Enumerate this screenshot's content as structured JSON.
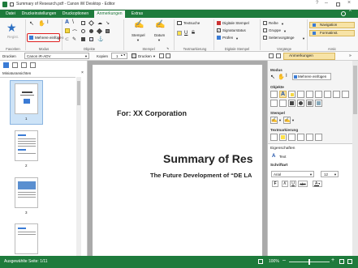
{
  "title": "Summary of Research.pdf - Canon iW Desktop - Editor",
  "tabs": [
    "Datei",
    "Druckeinstellungen",
    "Druckoptionen",
    "Anmerkungen",
    "Extras"
  ],
  "active_tab": "Anmerkungen",
  "ribbon": {
    "regist_label": "Regist.",
    "mehrere_einfuegen": "Mehrere einfügen",
    "stempel": "Stempel",
    "datum": "Datum",
    "textsuche": "Textsuche",
    "digitale_stempel": "Digitale Stempel",
    "signaturstatus": "Signaturstatus",
    "pruefen": "Prüfen",
    "reihe": "Reihe",
    "gruppe": "Gruppe",
    "seitenvorgaenge": "Seitenvorgänge",
    "navigation": "Navigation",
    "formatinst": "Formatinst.",
    "groups": {
      "favoriten": "Favoriten",
      "modus": "Modus",
      "objekte": "Objekte",
      "stempel": "Stempel",
      "textmarkierung": "Textmarkierung",
      "digitale_stempel": "Digitale Stempel",
      "vorgaenge": "Vorgänge",
      "ansic": "Ansic"
    }
  },
  "toolbar": {
    "drucken_label": "Drucken",
    "printer": "Canon iR-ADV",
    "kopien_label": "Kopien",
    "kopien_value": "1",
    "drucken_button": "Drucken",
    "anmerkungen_bar": "Anmerkungen"
  },
  "left": {
    "title": "Miniaturansichten",
    "pages": [
      "1",
      "2",
      "3"
    ]
  },
  "document": {
    "for_line": "For: XX Corporation",
    "heading": "Summary of Res",
    "subheading": "The Future Development of “DE LA"
  },
  "right": {
    "modus": "Modus",
    "mehrere_einfuegen": "Mehrere einfügen",
    "objekte": "Objekte",
    "stempel": "Stempel",
    "textmarkierung": "Textmarkierung",
    "eigenschaften": "Eigenschaften",
    "text": "Text",
    "schriftart": "Schriftart",
    "font": "Arial",
    "size": "12",
    "style_bold": "F",
    "style_italic": "K",
    "style_underline": "U",
    "style_strike": "abc"
  },
  "status": {
    "selected_pages": "Ausgewählte Seite: 1/11",
    "zoom": "100%"
  },
  "colors": {
    "brand": "#1e7b3c",
    "highlight_ring": "#e02020",
    "ribbon_bg": "#f7f7f7"
  }
}
